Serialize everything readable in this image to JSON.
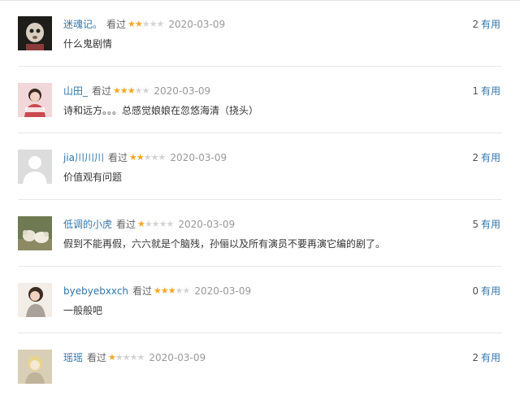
{
  "comments": [
    {
      "username": "迷魂记。",
      "watched": "看过",
      "rating": 2,
      "date": "2020-03-09",
      "text": "什么鬼剧情",
      "useful_count": "2",
      "useful_label": "有用",
      "avatar_colors": [
        "#1f1d1a",
        "#d8cfc0"
      ]
    },
    {
      "username": "山田_",
      "watched": "看过",
      "rating": 3,
      "date": "2020-03-09",
      "text": "诗和远方。。。总感觉娘娘在忽悠海清（挠头）",
      "useful_count": "1",
      "useful_label": "有用",
      "avatar_colors": [
        "#f1d7d9",
        "#c94a4f"
      ]
    },
    {
      "username": "jia川川川",
      "watched": "看过",
      "rating": 2,
      "date": "2020-03-09",
      "text": "价值观有问题",
      "useful_count": "2",
      "useful_label": "有用",
      "avatar_colors": [
        "#dcdcdc",
        "#ffffff"
      ]
    },
    {
      "username": "低调的小虎",
      "watched": "看过",
      "rating": 1,
      "date": "2020-03-09",
      "text": "假到不能再假，六六就是个脑残，孙俪以及所有演员不要再演它编的剧了。",
      "useful_count": "5",
      "useful_label": "有用",
      "avatar_colors": [
        "#6f7a52",
        "#eae4d6"
      ]
    },
    {
      "username": "byebyebxxch",
      "watched": "看过",
      "rating": 3,
      "date": "2020-03-09",
      "text": "一般般吧",
      "useful_count": "0",
      "useful_label": "有用",
      "avatar_colors": [
        "#f2ede6",
        "#3b2c24"
      ]
    },
    {
      "username": "瑶瑶",
      "watched": "看过",
      "rating": 1,
      "date": "2020-03-09",
      "text": "",
      "useful_count": "2",
      "useful_label": "有用",
      "avatar_colors": [
        "#d9cfb6",
        "#f3e9d4"
      ]
    }
  ],
  "colors": {
    "link": "#3377aa",
    "star": "#f5a623",
    "star_empty": "#d4d4d4",
    "date": "#999999"
  }
}
